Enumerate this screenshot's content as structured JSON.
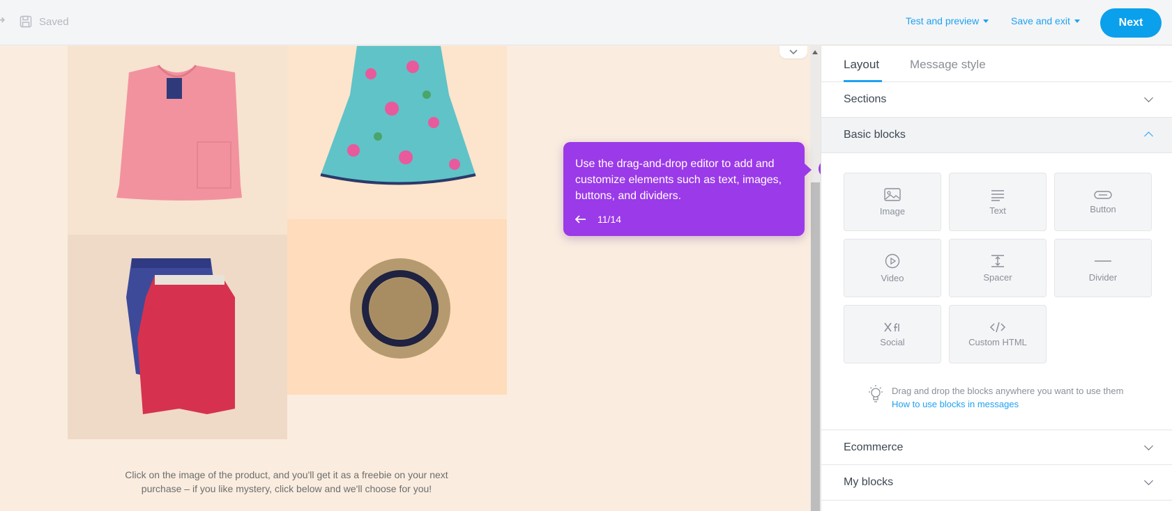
{
  "toolbar": {
    "saved_label": "Saved",
    "test_preview_label": "Test and preview",
    "save_exit_label": "Save and exit",
    "next_label": "Next"
  },
  "canvas": {
    "caption_line1": "Click on the image of the product, and you'll get it as a freebie on your next",
    "caption_line2": "purchase  – if you like mystery, click below and we'll choose for you!"
  },
  "tooltip": {
    "text": "Use the drag-and-drop editor to add and customize elements such as text, images, buttons, and dividers.",
    "step": "11/14"
  },
  "panel": {
    "tabs": [
      {
        "label": "Layout",
        "active": true
      },
      {
        "label": "Message style",
        "active": false
      }
    ],
    "sections_label": "Sections",
    "basic_blocks_label": "Basic blocks",
    "blocks": [
      {
        "label": "Image",
        "icon": "image-icon"
      },
      {
        "label": "Text",
        "icon": "text-icon"
      },
      {
        "label": "Button",
        "icon": "button-icon"
      },
      {
        "label": "Video",
        "icon": "video-icon"
      },
      {
        "label": "Spacer",
        "icon": "spacer-icon"
      },
      {
        "label": "Divider",
        "icon": "divider-icon"
      },
      {
        "label": "Social",
        "icon": "social-icon"
      },
      {
        "label": "Custom HTML",
        "icon": "code-icon"
      }
    ],
    "hint_text": "Drag and drop the blocks anywhere you want to use them",
    "hint_link": "How to use blocks in messages",
    "ecommerce_label": "Ecommerce",
    "my_blocks_label": "My blocks"
  },
  "colors": {
    "accent": "#1da1f2",
    "tooltip": "#9b3ae8",
    "canvas_bg": "#faeddf"
  }
}
